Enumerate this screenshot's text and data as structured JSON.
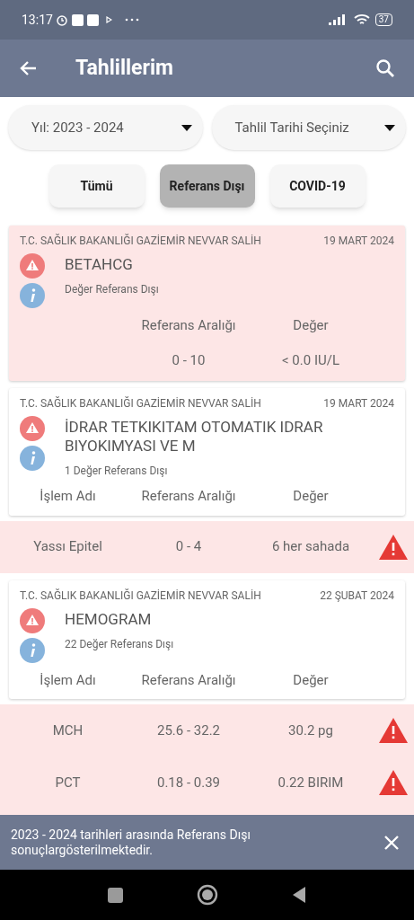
{
  "status_bar": {
    "time": "13:17",
    "battery": "37"
  },
  "app_bar": {
    "title": "Tahlillerim"
  },
  "filters": [
    {
      "label": "Yıl: 2023 - 2024"
    },
    {
      "label": "Tahlil Tarihi Seçiniz"
    }
  ],
  "chips": [
    {
      "label": "Tümü",
      "selected": false
    },
    {
      "label": "Referans Dışı",
      "selected": true
    },
    {
      "label": "COVID-19",
      "selected": false
    }
  ],
  "results": [
    {
      "kind": "single",
      "out_of_range": true,
      "institution": "T.C. SAĞLIK BAKANLIĞI GAZİEMİR NEVVAR SALİH",
      "date": "19 MART 2024",
      "name": "BETAHCG",
      "summary": "Değer Referans Dışı",
      "columns": [
        "Referans Aralığı",
        "Değer"
      ],
      "values": [
        "0 - 10",
        "< 0.0 IU/L"
      ]
    },
    {
      "kind": "group",
      "out_of_range": false,
      "institution": "T.C. SAĞLIK BAKANLIĞI GAZİEMİR NEVVAR SALİH",
      "date": "19 MART 2024",
      "name": "İDRAR TETKIKITAM OTOMATIK IDRAR BIYOKIMYASI VE M",
      "summary": "1 Değer Referans Dışı",
      "columns": [
        "İşlem Adı",
        "Referans Aralığı",
        "Değer"
      ],
      "rows": [
        {
          "name": "Yassı Epitel",
          "range": "0 - 4",
          "value": "6 her sahada",
          "flagged": true
        }
      ]
    },
    {
      "kind": "group",
      "out_of_range": false,
      "institution": "T.C. SAĞLIK BAKANLIĞI GAZİEMİR NEVVAR SALİH",
      "date": "22 ŞUBAT 2024",
      "name": "HEMOGRAM",
      "summary": "22 Değer Referans Dışı",
      "columns": [
        "İşlem Adı",
        "Referans Aralığı",
        "Değer"
      ],
      "rows": [
        {
          "name": "MCH",
          "range": "25.6 - 32.2",
          "value": "30.2 pg",
          "flagged": true
        },
        {
          "name": "PCT",
          "range": "0.18 - 0.39",
          "value": "0.22 BIRIM",
          "flagged": true
        }
      ]
    }
  ],
  "snackbar": {
    "message": "2023 - 2024 tarihleri arasında Referans Dışı sonuçlargösterilmektedir."
  }
}
